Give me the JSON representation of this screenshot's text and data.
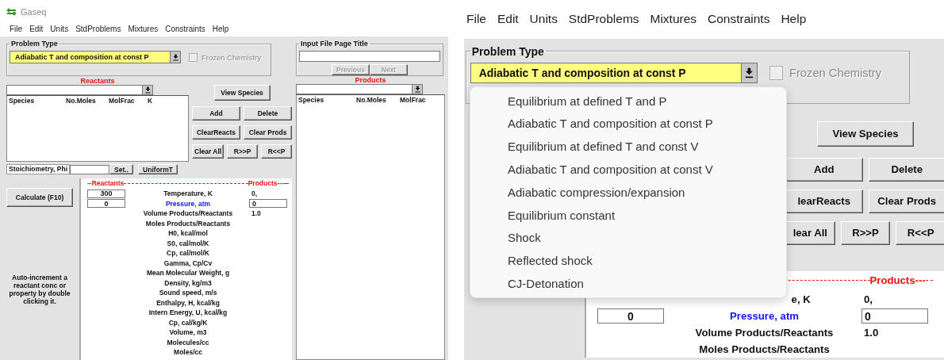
{
  "left": {
    "window": {
      "title": "Gaseq"
    },
    "menu": [
      "File",
      "Edit",
      "Units",
      "StdProblems",
      "Mixtures",
      "Constraints",
      "Help"
    ],
    "problem_type": {
      "legend": "Problem Type",
      "value": "Adiabatic T and composition at const P"
    },
    "frozen_chemistry": {
      "label": "Frozen Chemistry",
      "checked": false,
      "disabled": true
    },
    "input_file": {
      "legend": "Input File Page Title",
      "buttons": [
        {
          "label": "Previous",
          "disabled": true
        },
        {
          "label": "Next",
          "disabled": true
        }
      ]
    },
    "reactants": {
      "label": "Reactants",
      "columns": [
        "Species",
        "No.Moles",
        "MolFrac",
        "K"
      ]
    },
    "products": {
      "label": "Products",
      "columns": [
        "Species",
        "No.Moles",
        "MolFrac"
      ]
    },
    "view_species": "View Species",
    "button_rows": [
      [
        "Add",
        "Delete"
      ],
      [
        "ClearReacts",
        "Clear Prods"
      ],
      [
        "Clear All",
        "R>>P",
        "R<<P"
      ]
    ],
    "stoichiometry": {
      "label": "Stoichiometry, Phi",
      "buttons": [
        "Set..",
        "UniformT"
      ]
    },
    "calculate": "Calculate (F10)",
    "hint": "Auto-increment a reactant conc or property by double clicking it.",
    "properties": {
      "reactants_header": "--Reactants",
      "products_header": "Products---",
      "rows": [
        {
          "label": "Temperature, K",
          "selected": false,
          "reactant": {
            "kind": "field",
            "value": "300"
          },
          "product": {
            "kind": "text",
            "value": "0,"
          }
        },
        {
          "label": "Pressure, atm",
          "selected": true,
          "reactant": {
            "kind": "field",
            "value": "0"
          },
          "product": {
            "kind": "field",
            "value": "0"
          }
        },
        {
          "label": "Volume Products/Reactants",
          "selected": false,
          "product": {
            "kind": "text",
            "value": "1.0"
          }
        },
        {
          "label": "Moles Products/Reactants",
          "selected": false
        },
        {
          "label": "H0,  kcal/mol",
          "selected": false
        },
        {
          "label": "S0,  cal/mol/K",
          "selected": false
        },
        {
          "label": "Cp,  cal/mol/K",
          "selected": false
        },
        {
          "label": "Gamma, Cp/Cv",
          "selected": false
        },
        {
          "label": "Mean Molecular Weight, g",
          "selected": false
        },
        {
          "label": "Density,  kg/m3",
          "selected": false
        },
        {
          "label": "Sound speed,  m/s",
          "selected": false
        },
        {
          "label": "Enthalpy, H,  kcal/kg",
          "selected": false
        },
        {
          "label": "Intern Energy, U,  kcal/kg",
          "selected": false
        },
        {
          "label": "Cp, cal/kg/K",
          "selected": false
        },
        {
          "label": "Volume,  m3",
          "selected": false
        },
        {
          "label": "Molecules/cc",
          "selected": false
        },
        {
          "label": "Moles/cc",
          "selected": false
        }
      ]
    }
  },
  "right": {
    "menu": [
      "File",
      "Edit",
      "Units",
      "StdProblems",
      "Mixtures",
      "Constraints",
      "Help"
    ],
    "problem_type": {
      "legend": "Problem Type",
      "value": "Adiabatic T and composition at const P"
    },
    "frozen_chemistry": {
      "label": "Frozen Chemistry",
      "checked": false,
      "disabled": true
    },
    "options": [
      {
        "label": "Equilibrium at defined T and P",
        "selected": false
      },
      {
        "label": "Adiabatic T and composition at const P",
        "selected": false
      },
      {
        "label": "Equilibrium at defined T and const V",
        "selected": false
      },
      {
        "label": "Adiabatic T and composition at const V",
        "selected": false
      },
      {
        "label": "Adiabatic compression/expansion",
        "selected": false
      },
      {
        "label": "Equilibrium constant",
        "selected": false
      },
      {
        "label": "Shock",
        "selected": false
      },
      {
        "label": "Reflected shock",
        "selected": false
      },
      {
        "label": "CJ-Detonation",
        "selected": false
      }
    ],
    "view_species": "View Species",
    "button_rows": [
      [
        "Add",
        "Delete"
      ],
      [
        "learReacts",
        "Clear Prods"
      ],
      [
        "lear All",
        "R>>P",
        "R<<P"
      ]
    ],
    "properties": {
      "products_header": "Products---",
      "rows": [
        {
          "label": "e, K",
          "selected": false,
          "truncated": true,
          "product": {
            "kind": "text",
            "value": "0,"
          }
        },
        {
          "label": "Pressure, atm",
          "selected": true,
          "reactant": {
            "kind": "field",
            "value": "0"
          },
          "product": {
            "kind": "field",
            "value": "0"
          }
        },
        {
          "label": "Volume Products/Reactants",
          "selected": false,
          "product": {
            "kind": "text",
            "value": "1.0"
          }
        },
        {
          "label": "Moles Products/Reactants",
          "selected": false
        }
      ]
    }
  }
}
